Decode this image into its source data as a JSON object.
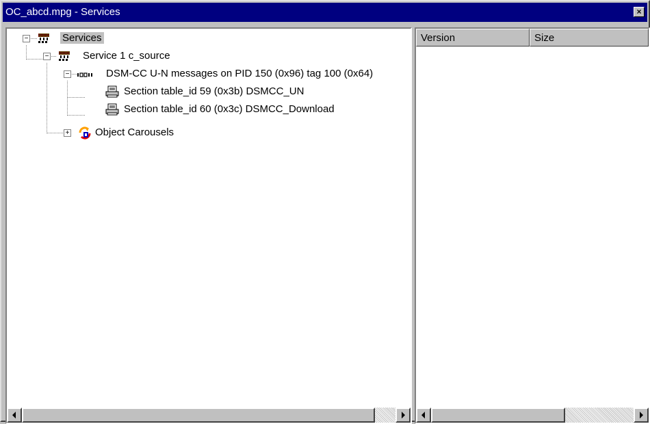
{
  "window": {
    "title": "OC_abcd.mpg - Services",
    "close_glyph": "×"
  },
  "tree": {
    "root": {
      "label": "Services",
      "expander": "−",
      "icon": "network-service-icon"
    },
    "service": {
      "label": "Service 1 c_source",
      "expander": "−",
      "icon": "network-service-icon"
    },
    "pid": {
      "label": "DSM-CC U-N messages on PID 150 (0x96) tag 100 (0x64)",
      "expander": "−",
      "icon": "pid-stream-icon"
    },
    "sections": [
      {
        "label": "Section table_id 59 (0x3b) DSMCC_UN",
        "icon": "section-table-icon"
      },
      {
        "label": "Section table_id 60 (0x3c) DSMCC_Download",
        "icon": "section-table-icon"
      }
    ],
    "carousel": {
      "label": "Object Carousels",
      "expander": "+",
      "icon": "object-carousel-icon"
    }
  },
  "list": {
    "columns": [
      "Version",
      "Size"
    ]
  },
  "colors": {
    "titlebar": "#000080",
    "face": "#c0c0c0",
    "selection": "#c0c0c0"
  }
}
